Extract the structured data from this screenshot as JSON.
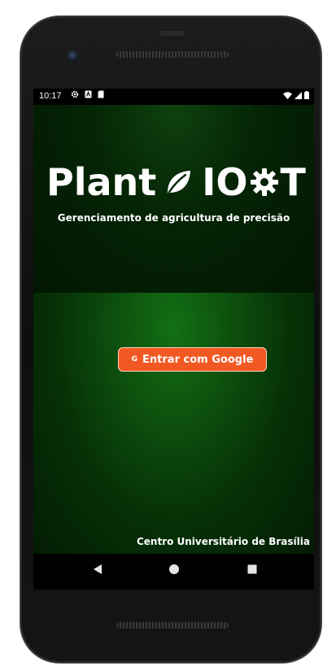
{
  "status_bar": {
    "time": "10:17",
    "left_icons": [
      "settings-icon",
      "accessibility-icon",
      "sd-card-icon"
    ],
    "right_icons": [
      "wifi-icon",
      "signal-icon",
      "battery-icon"
    ]
  },
  "app": {
    "title_part1": "Plant",
    "title_part2": "IO",
    "title_part3": "T",
    "subtitle": "Gerenciamento de agricultura de precisão",
    "login_button": {
      "icon_letter": "G",
      "label": "Entrar com Google"
    },
    "footer": "Centro Universitário de Brasília"
  },
  "colors": {
    "button_bg": "#f25922",
    "header_bg": "#021702",
    "body_green": "#137014"
  },
  "nav_bar": {
    "icons": [
      "back-icon",
      "home-icon",
      "recents-icon"
    ]
  }
}
